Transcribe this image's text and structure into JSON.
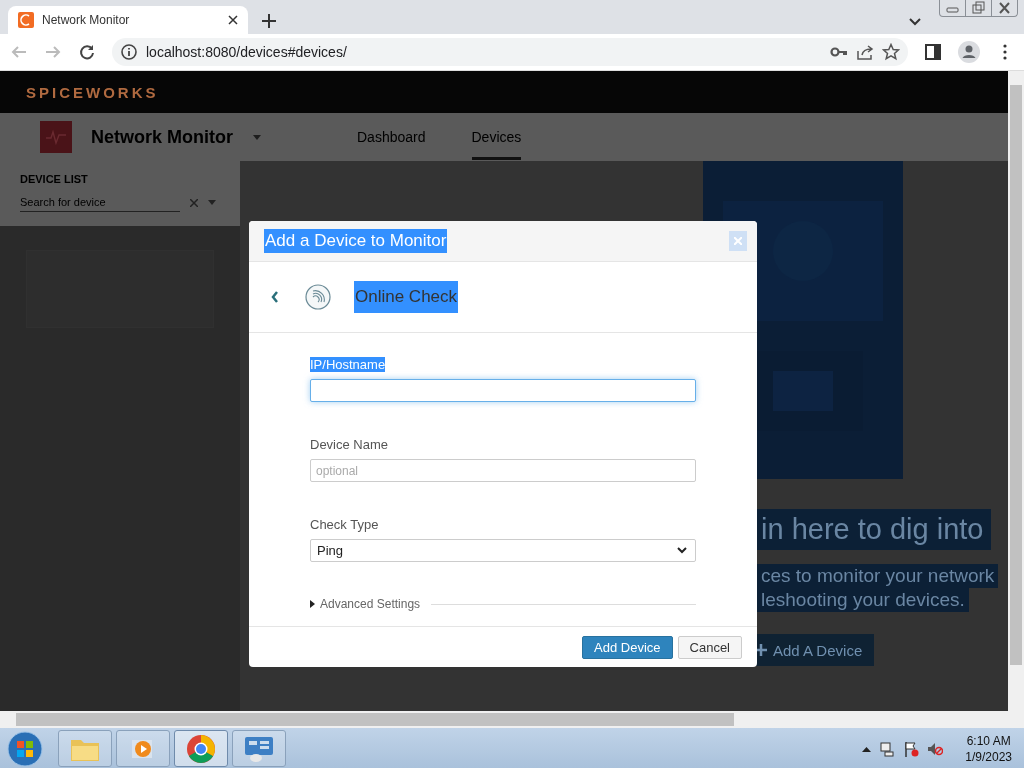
{
  "browser": {
    "tabs": [
      {
        "title": "Network Monitor",
        "selected": true
      }
    ],
    "url": "localhost:8080/devices#devices/"
  },
  "page": {
    "brand": "SPICEWORKS",
    "app_title": "Network Monitor",
    "nav": [
      {
        "label": "Dashboard",
        "selected": false
      },
      {
        "label": "Devices",
        "selected": true
      }
    ],
    "sidebar": {
      "heading": "DEVICE LIST",
      "search": {
        "placeholder": "Search for device"
      }
    },
    "hero": {
      "heading": "in here to dig into",
      "lines": [
        "ces to monitor your network",
        "leshooting your devices."
      ],
      "button": "Add A Device"
    }
  },
  "dialog": {
    "title": "Add a Device to Monitor",
    "title_highlighted": true,
    "step": "Online Check",
    "step_highlighted": true,
    "fields": [
      {
        "kind": "text",
        "label": "IP/Hostname",
        "label_highlighted": true,
        "focused": true
      },
      {
        "kind": "text",
        "label": "Device Name",
        "placeholder": "optional",
        "label_highlighted": false,
        "focused": false
      },
      {
        "kind": "select",
        "label": "Check Type",
        "value": "Ping",
        "label_highlighted": false,
        "focused": false
      }
    ],
    "advanced": "Advanced Settings",
    "buttons": [
      {
        "label": "Add Device",
        "primary": true
      },
      {
        "label": "Cancel",
        "primary": false
      }
    ]
  },
  "taskbar": {
    "apps": [
      {
        "kind": "folder",
        "selected": false
      },
      {
        "kind": "media",
        "selected": false
      },
      {
        "kind": "chrome",
        "selected": true
      },
      {
        "kind": "control",
        "selected": false
      }
    ],
    "time": "6:10 AM",
    "date": "1/9/2023"
  }
}
